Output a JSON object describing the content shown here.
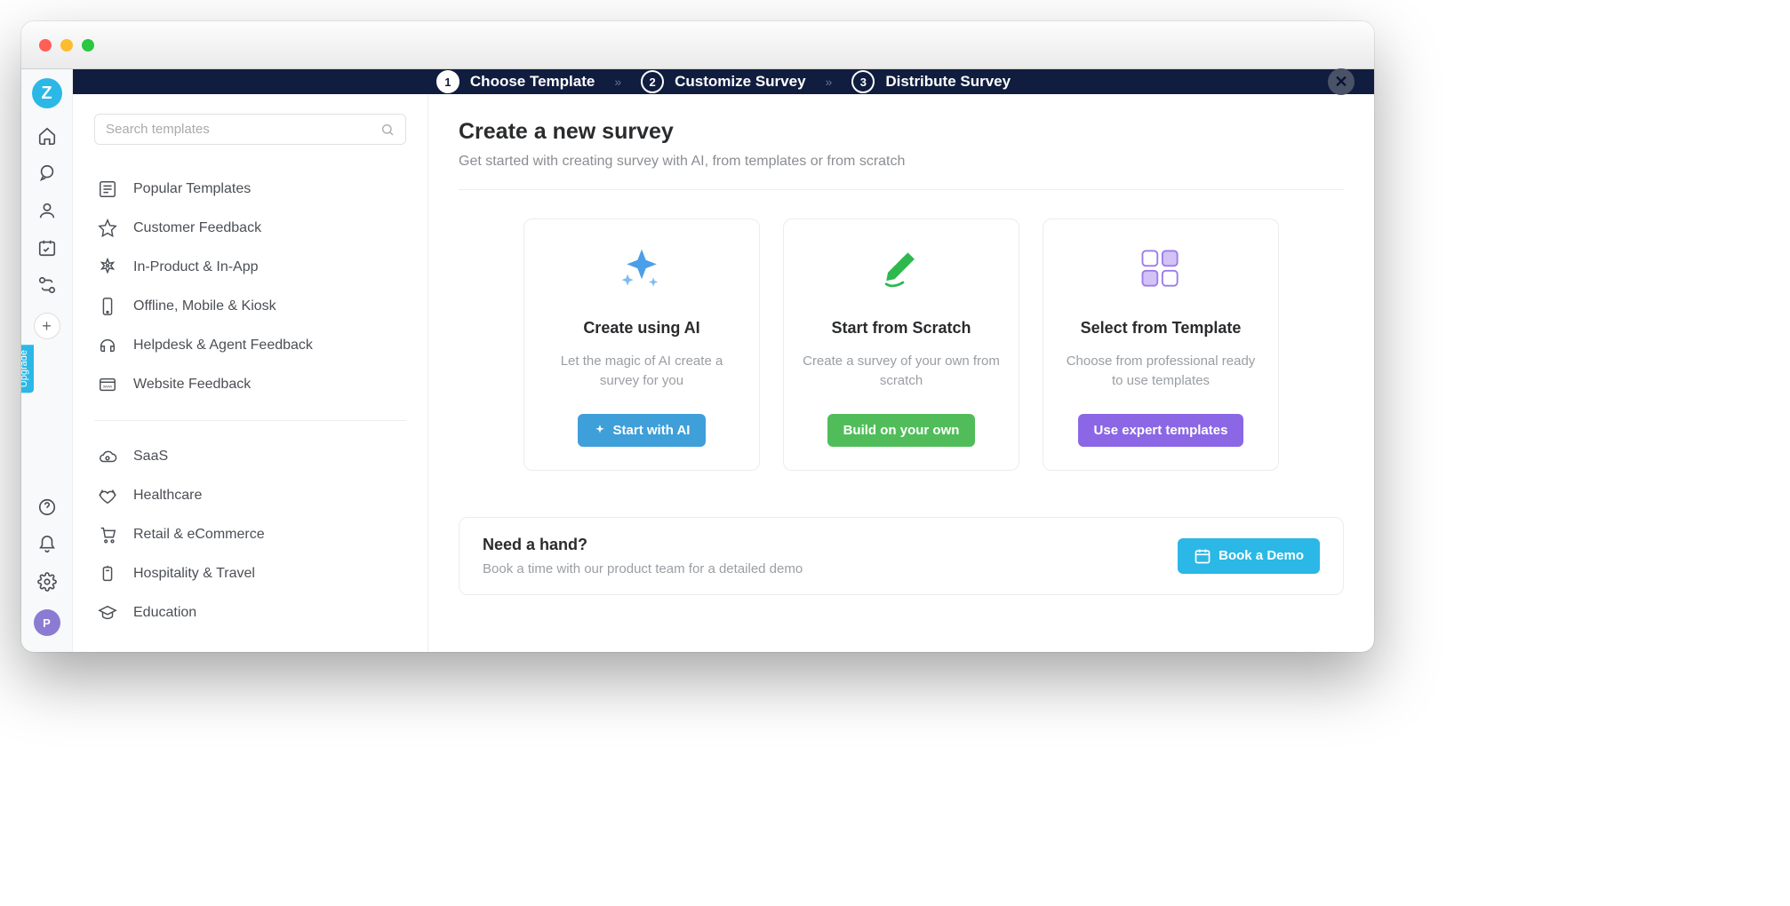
{
  "rail": {
    "logo_letter": "Z",
    "upgrade_label": "Upgrade",
    "avatar_letter": "P"
  },
  "stepbar": {
    "steps": [
      {
        "num": "1",
        "label": "Choose Template",
        "active": true
      },
      {
        "num": "2",
        "label": "Customize Survey",
        "active": false
      },
      {
        "num": "3",
        "label": "Distribute Survey",
        "active": false
      }
    ]
  },
  "search": {
    "placeholder": "Search templates"
  },
  "categories1": [
    {
      "id": "popular",
      "label": "Popular Templates"
    },
    {
      "id": "customer",
      "label": "Customer Feedback"
    },
    {
      "id": "inproduct",
      "label": "In-Product & In-App"
    },
    {
      "id": "offline",
      "label": "Offline, Mobile & Kiosk"
    },
    {
      "id": "helpdesk",
      "label": "Helpdesk & Agent Feedback"
    },
    {
      "id": "website",
      "label": "Website Feedback"
    }
  ],
  "categories2": [
    {
      "id": "saas",
      "label": "SaaS"
    },
    {
      "id": "healthcare",
      "label": "Healthcare"
    },
    {
      "id": "retail",
      "label": "Retail & eCommerce"
    },
    {
      "id": "hospitality",
      "label": "Hospitality & Travel"
    },
    {
      "id": "education",
      "label": "Education"
    }
  ],
  "main": {
    "title": "Create a new survey",
    "subtitle": "Get started with creating survey with AI, from templates or from scratch"
  },
  "cards": {
    "ai": {
      "title": "Create using AI",
      "desc": "Let the magic of AI create a survey for you",
      "button": "Start with AI"
    },
    "scratch": {
      "title": "Start from Scratch",
      "desc": "Create a survey of your own from scratch",
      "button": "Build on your own"
    },
    "template": {
      "title": "Select from Template",
      "desc": "Choose from professional ready to use templates",
      "button": "Use expert templates"
    }
  },
  "help": {
    "title": "Need a hand?",
    "desc": "Book a time with our product team for a detailed demo",
    "button": "Book a Demo"
  }
}
